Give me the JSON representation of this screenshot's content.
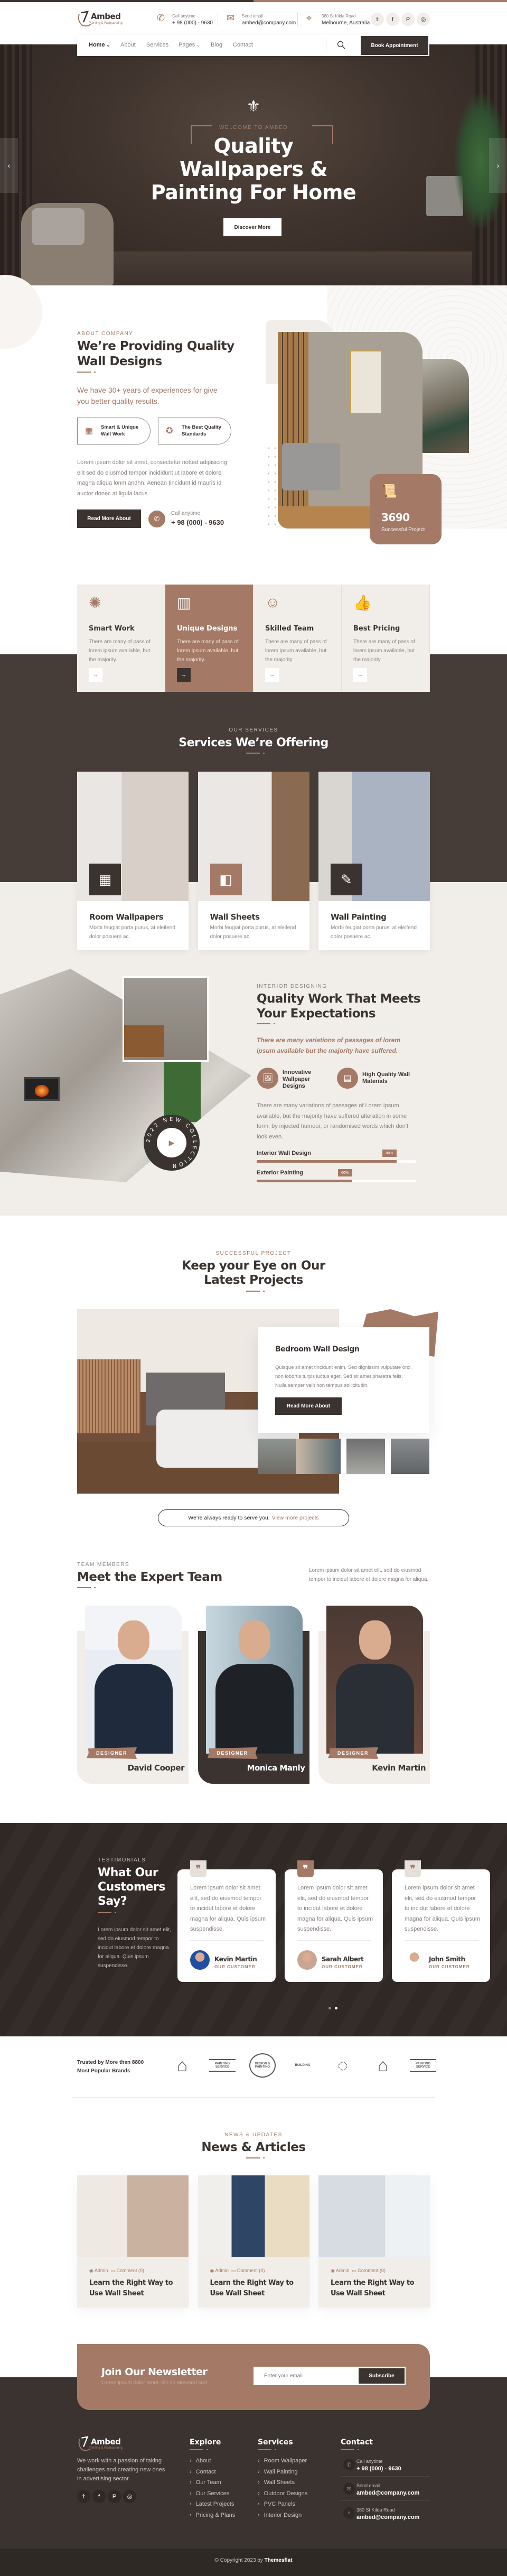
{
  "colors": {
    "dark": "#3a3330",
    "brown": "#a47a66",
    "beige": "#f1ede9"
  },
  "header": {
    "logo": {
      "name": "Ambed",
      "tagline": "Painting & Wallpapering"
    },
    "contacts": [
      {
        "icon": "phone-icon",
        "label": "Call anytime",
        "value": "+ 98 (000) - 9630"
      },
      {
        "icon": "email-icon",
        "label": "Send email",
        "value": "ambed@company.com"
      },
      {
        "icon": "location-icon",
        "label": "380 St Kilda Road",
        "value": "Melbourne, Australia"
      }
    ],
    "socials": [
      "twitter-icon",
      "facebook-icon",
      "pinterest-icon",
      "instagram-icon"
    ]
  },
  "nav": {
    "items": [
      {
        "label": "Home",
        "dropdown": true
      },
      {
        "label": "About"
      },
      {
        "label": "Services"
      },
      {
        "label": "Pages",
        "dropdown": true
      },
      {
        "label": "Blog"
      },
      {
        "label": "Contact"
      }
    ],
    "cta": "Book Appointment"
  },
  "hero": {
    "eyebrow": "WELCOME TO AMBED",
    "title_lines": [
      "Quality",
      "Wallpapers &",
      "Painting For Home"
    ],
    "button": "Discover More"
  },
  "about": {
    "eyebrow": "ABOUT COMPANY",
    "title_lines": [
      "We’re Providing Quality",
      "Wall Designs"
    ],
    "subtitle": "We have 30+ years of experiences for give you better quality results.",
    "pills": [
      "Smart & Unique Wall Work",
      "The Best Quality Standards"
    ],
    "text": "Lorem ipsum dolor sit amet, consectetur notted adipisicing elit sed do eiusmod tempor incididunt ut labore et dolore magna aliqua lonm andhn. Aenean tincidunt id mauris id auctor donec at ligula lacus.",
    "button": "Read More About",
    "call_label": "Call anytime",
    "call_value": "+ 98 (000) - 9630",
    "stat_value": "3690",
    "stat_label": "Successful Project"
  },
  "features": [
    {
      "title": "Smart Work",
      "text": "There are many of pass of lorem ipsum available, but the majority.",
      "active": false
    },
    {
      "title": "Unique Designs",
      "text": "There are many of pass of lorem ipsum available, but the majority.",
      "active": true
    },
    {
      "title": "Skilled Team",
      "text": "There are many of pass of lorem ipsum available, but the majority.",
      "active": false
    },
    {
      "title": "Best Pricing",
      "text": "There are many of pass of lorem ipsum available, but the majority.",
      "active": false
    }
  ],
  "services": {
    "eyebrow": "OUR SERVICES",
    "title": "Services We’re Offering",
    "items": [
      {
        "title": "Room Wallpapers",
        "text": "Morbi feugiat porta purus, at eleifend dolor posuere ac."
      },
      {
        "title": "Wall Sheets",
        "text": "Morbi feugiat porta purus, at eleifend dolor posuere ac."
      },
      {
        "title": "Wall Painting",
        "text": "Morbi feugiat porta purus, at eleifend dolor posuere ac."
      }
    ]
  },
  "interior": {
    "eyebrow": "INTERIOR DESIGNING",
    "title_lines": [
      "Quality Work That Meets",
      "Your Expectations"
    ],
    "italic": "There are many variations of passages of lorem ipsum available but the majority have suffered.",
    "features": [
      "Innovative Wallpaper Designs",
      "High Quality Wall Materials"
    ],
    "text": "There are many variations of passages of Lorem Ipsum available, but the majority have suffered alteration in some form, by injected humour, or randomised words which don't look even.",
    "badge": "2022 NEW COLLECTION",
    "skills": [
      {
        "label": "Interior Wall Design",
        "percent": 88
      },
      {
        "label": "Exterior Painting",
        "percent": 60
      }
    ]
  },
  "projects": {
    "eyebrow": "SUCCESSFUL PROJECT",
    "title_lines": [
      "Keep your Eye on Our",
      "Latest Projects"
    ],
    "card_title": "Bedroom Wall Design",
    "card_text": "Quisque sit amet tincidunt enim. Sed dignissim vulputate orci, non lobortis turpis luctus eget. Sed sit amet pharetra felis. Nulla semper velit non tempus sollicitudin.",
    "button": "Read More About",
    "cta_text": "We’re always ready to serve you.",
    "cta_link": "View more projects"
  },
  "team": {
    "eyebrow": "TEAM MEMBERS",
    "title": "Meet the Expert Team",
    "text": "Lorem ipsum dolor sit amet elit, sed do eiusmod tempor to incidut labore et dolore magna for aliqua.",
    "members": [
      {
        "name": "David Cooper",
        "role": "DESIGNER"
      },
      {
        "name": "Monica Manly",
        "role": "DESIGNER"
      },
      {
        "name": "Kevin Martin",
        "role": "DESIGNER"
      }
    ]
  },
  "testimonials": {
    "eyebrow": "TESTIMONIALS",
    "title_lines": [
      "What Our",
      "Customers",
      "Say?"
    ],
    "text": "Lorem ipsum dolor sit amet elit, sed do eiusmod tempor to incidut labore et dolore magna for aliqua. Quis ipsum suspendisse.",
    "items": [
      {
        "text": "Lorem ipsum dolor sit amet elit, sed do eiusmod tempor to incidut labore et dolore magna for aliqua. Quis ipsum suspendisse.",
        "name": "Kevin Martin",
        "role": "OUR CUSTOMER"
      },
      {
        "text": "Lorem ipsum dolor sit amet elit, sed do eiusmod tempor to incidut labore et dolore magna for aliqua. Quis ipsum suspendisse.",
        "name": "Sarah Albert",
        "role": "OUR CUSTOMER"
      },
      {
        "text": "Lorem ipsum dolor sit amet elit, sed do eiusmod tempor to incidut labore et dolore magna for aliqua. Quis ipsum suspendisse.",
        "name": "John Smith",
        "role": "OUR CUSTOMER"
      }
    ]
  },
  "brands": {
    "text_lines": [
      "Trusted by More then 8800",
      "Most Popular Brands"
    ],
    "logos": [
      "PAINTING SERVICE",
      "DESIGN & PAINTING",
      "BUILDING"
    ]
  },
  "news": {
    "eyebrow": "NEWS & UPDATES",
    "title": "News & Articles",
    "items": [
      {
        "author": "Admin",
        "comments": "Comment (0)",
        "title": "Learn the Right Way to Use Wall Sheet"
      },
      {
        "author": "Admin",
        "comments": "Comment (0)",
        "title": "Learn the Right Way to Use Wall Sheet"
      },
      {
        "author": "Admin",
        "comments": "Comment (0)",
        "title": "Learn the Right Way to Use Wall Sheet"
      }
    ]
  },
  "newsletter": {
    "title": "Join Our Newsletter",
    "text": "Lorem ipsum dolor amet, elit do eiusmod sed",
    "placeholder": "Enter your email",
    "button": "Subscribe"
  },
  "footer": {
    "about": "We work with a passion of taking challenges and creating new ones in advertising sector.",
    "explore_title": "Explore",
    "explore": [
      "About",
      "Contact",
      "Our Team",
      "Our Services",
      "Latest Projects",
      "Pricing & Plans"
    ],
    "services_title": "Services",
    "services": [
      "Room Wallpaper",
      "Wall Painting",
      "Wall Sheets",
      "Outdoor Designs",
      "PVC Panels",
      "Interior Design"
    ],
    "contact_title": "Contact",
    "contacts": [
      {
        "label": "Call anytime",
        "value": "+ 98 (000) - 9630"
      },
      {
        "label": "Send email",
        "value": "ambed@company.com"
      },
      {
        "label": "380 St Kilda Road",
        "value": "ambed@company.com"
      }
    ],
    "copyright": "© Copyright 2023 by",
    "copyright_brand": "Themesflat"
  }
}
